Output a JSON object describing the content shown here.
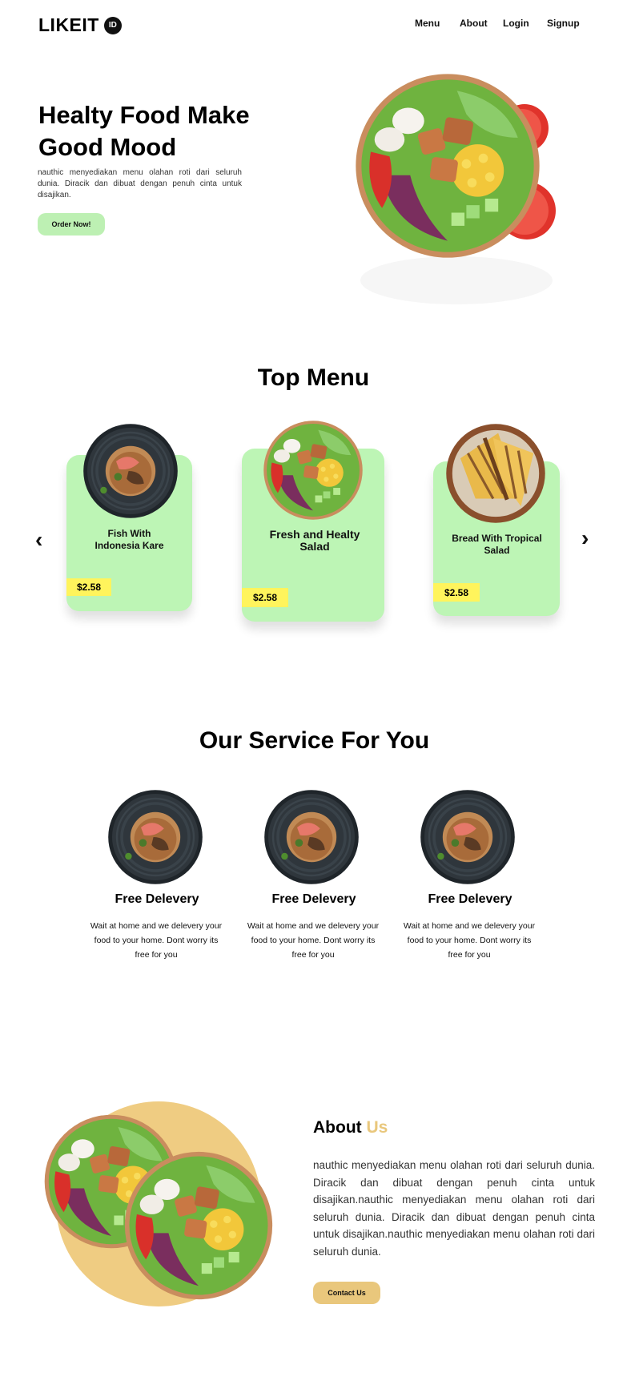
{
  "nav": {
    "logo": "LIKEIT",
    "badge": "ID",
    "links": [
      "Menu",
      "About",
      "Login",
      "Signup"
    ]
  },
  "hero": {
    "title": "Healty Food Make Good Mood",
    "description": "nauthic menyediakan menu olahan roti dari seluruh dunia. Diracik dan dibuat dengan penuh cinta untuk disajikan.",
    "cta": "Order Now!",
    "image": "salad-bowl-image"
  },
  "top_menu": {
    "title": "Top Menu",
    "items": [
      {
        "name": "Fish With Indonesia Kare",
        "price": "$2.58",
        "image": "curry-dish-image"
      },
      {
        "name": "Fresh and Healty Salad",
        "price": "$2.58",
        "image": "salad-bowl-image"
      },
      {
        "name": "Bread With Tropical Salad",
        "price": "$2.58",
        "image": "toast-bowl-image"
      }
    ],
    "prev_icon": "chevron-left-icon",
    "next_icon": "chevron-right-icon"
  },
  "services": {
    "title": "Our Service For You",
    "items": [
      {
        "title": "Free Delevery",
        "description": "Wait at home and we delevery your food to your home. Dont worry its free for you"
      },
      {
        "title": "Free Delevery",
        "description": "Wait at home and we delevery your food to your home. Dont worry its free for you"
      },
      {
        "title": "Free Delevery",
        "description": "Wait at home and we delevery your food to your home. Dont worry its free for you"
      }
    ]
  },
  "about": {
    "title": "About",
    "title_accent": "Us",
    "description": "nauthic menyediakan menu olahan roti dari seluruh dunia. Diracik dan dibuat dengan penuh cinta untuk disajikan.nauthic menyediakan menu olahan roti dari seluruh dunia. Diracik dan dibuat dengan penuh cinta untuk disajikan.nauthic menyediakan menu olahan roti dari seluruh dunia.",
    "cta": "Contact Us"
  },
  "colors": {
    "green": "#bdf5b5",
    "yellow": "#fff45c",
    "gold": "#e9c77c"
  }
}
